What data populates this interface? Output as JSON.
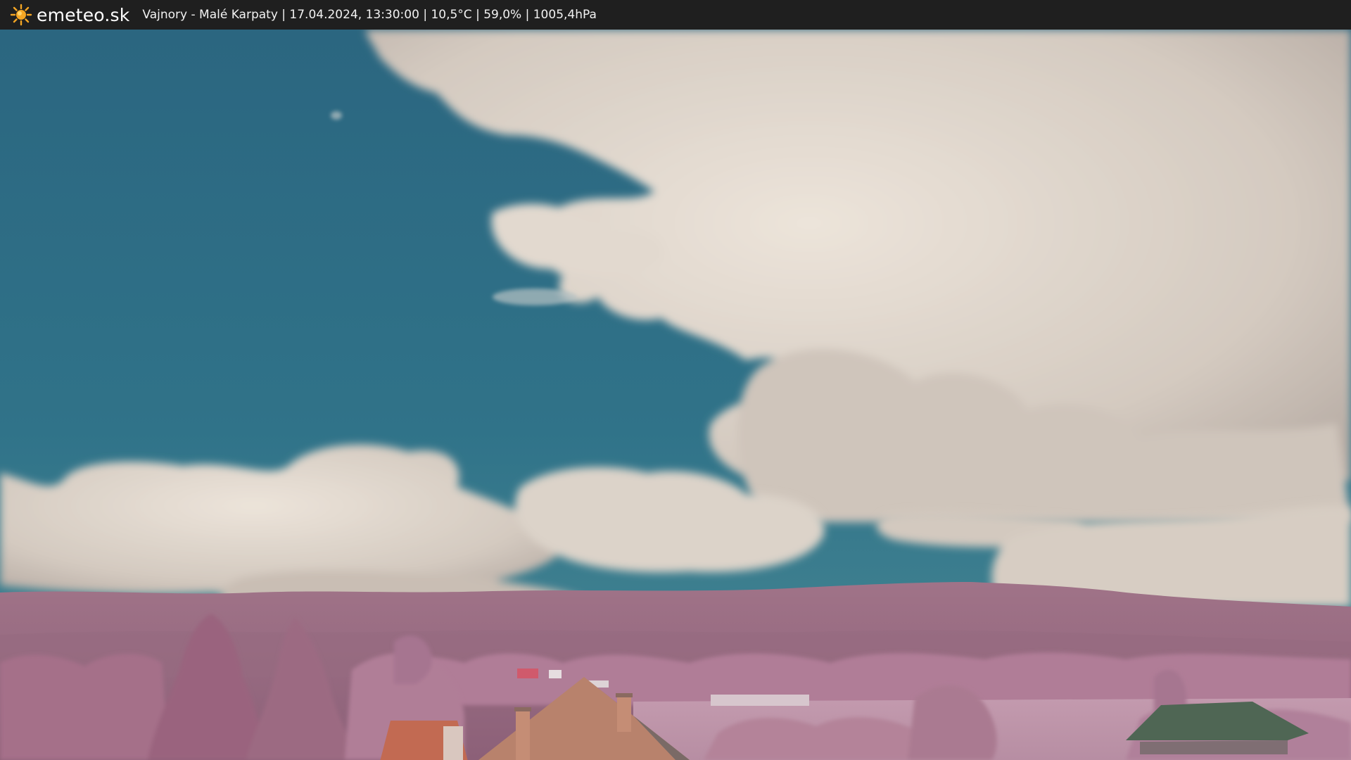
{
  "header": {
    "brand_name": "emeteo.sk",
    "logo_icon": "sun-icon",
    "caption": "Vajnory - Malé Karpaty | 17.04.2024, 13:30:00 | 10,5°C | 59,0% | 1005,4hPa"
  },
  "colors": {
    "bar_background": "#1f1f1f",
    "logo_sun": "#f5a623",
    "sky": "#2f7087",
    "cloud": "#d9d0c8",
    "foliage": "#b27c9a",
    "roof": "#c0644e"
  }
}
